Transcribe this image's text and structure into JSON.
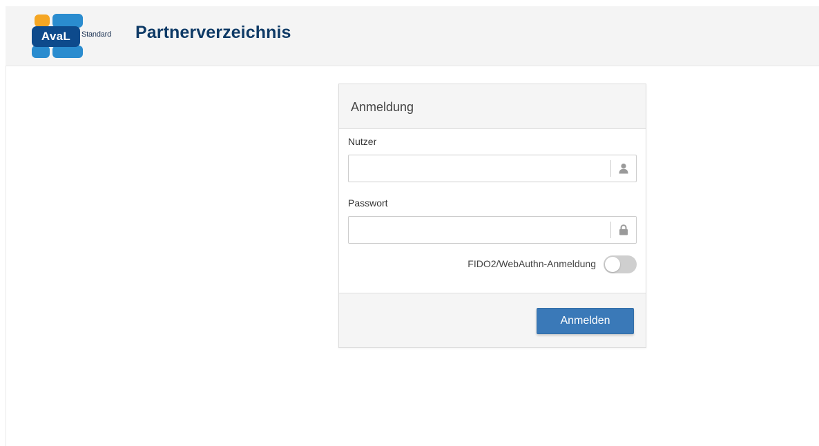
{
  "header": {
    "logo_text": "AvaL",
    "logo_tagline": "Standard",
    "app_title": "Partnerverzeichnis",
    "colors": {
      "logo_dark_blue": "#0d4a8c",
      "logo_blue": "#2a8ccf",
      "logo_orange": "#f5a623",
      "title": "#0e3a66"
    }
  },
  "login": {
    "heading": "Anmeldung",
    "user": {
      "label": "Nutzer",
      "value": "",
      "placeholder": "",
      "icon": "user-icon"
    },
    "password": {
      "label": "Passwort",
      "value": "",
      "placeholder": "",
      "icon": "lock-icon"
    },
    "fido_toggle": {
      "label": "FIDO2/WebAuthn-Anmeldung",
      "enabled": false
    },
    "submit_label": "Anmelden",
    "colors": {
      "button": "#3a79b8",
      "toggle_off": "#cfcfcf"
    }
  }
}
